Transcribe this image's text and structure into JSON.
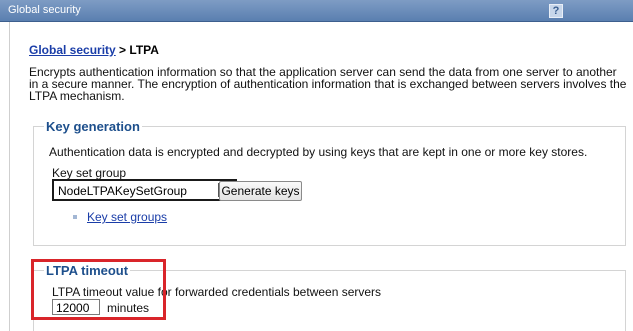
{
  "window": {
    "title": "Global security",
    "help_glyph": "?"
  },
  "breadcrumb": {
    "link": "Global security",
    "separator": " > ",
    "current": "LTPA"
  },
  "description": "Encrypts authentication information so that the application server can send the data from one server to another in a secure manner. The encryption of authentication information that is exchanged between servers involves the LTPA mechanism.",
  "key_generation": {
    "legend": "Key generation",
    "text": "Authentication data is encrypted and decrypted by using keys that are kept in one or more key stores.",
    "key_set_group_label": "Key set group",
    "key_set_group_value": "NodeLTPAKeySetGroup",
    "generate_button": "Generate keys",
    "key_set_groups_link": "Key set groups"
  },
  "ltpa_timeout": {
    "legend": "LTPA timeout",
    "text": "LTPA timeout value for forwarded credentials between servers",
    "value": "12000",
    "unit": "minutes"
  },
  "colors": {
    "titlebar": "#5a7fb0",
    "legend": "#1d4f8c",
    "link": "#1a3da8",
    "highlight": "#d9252a"
  }
}
